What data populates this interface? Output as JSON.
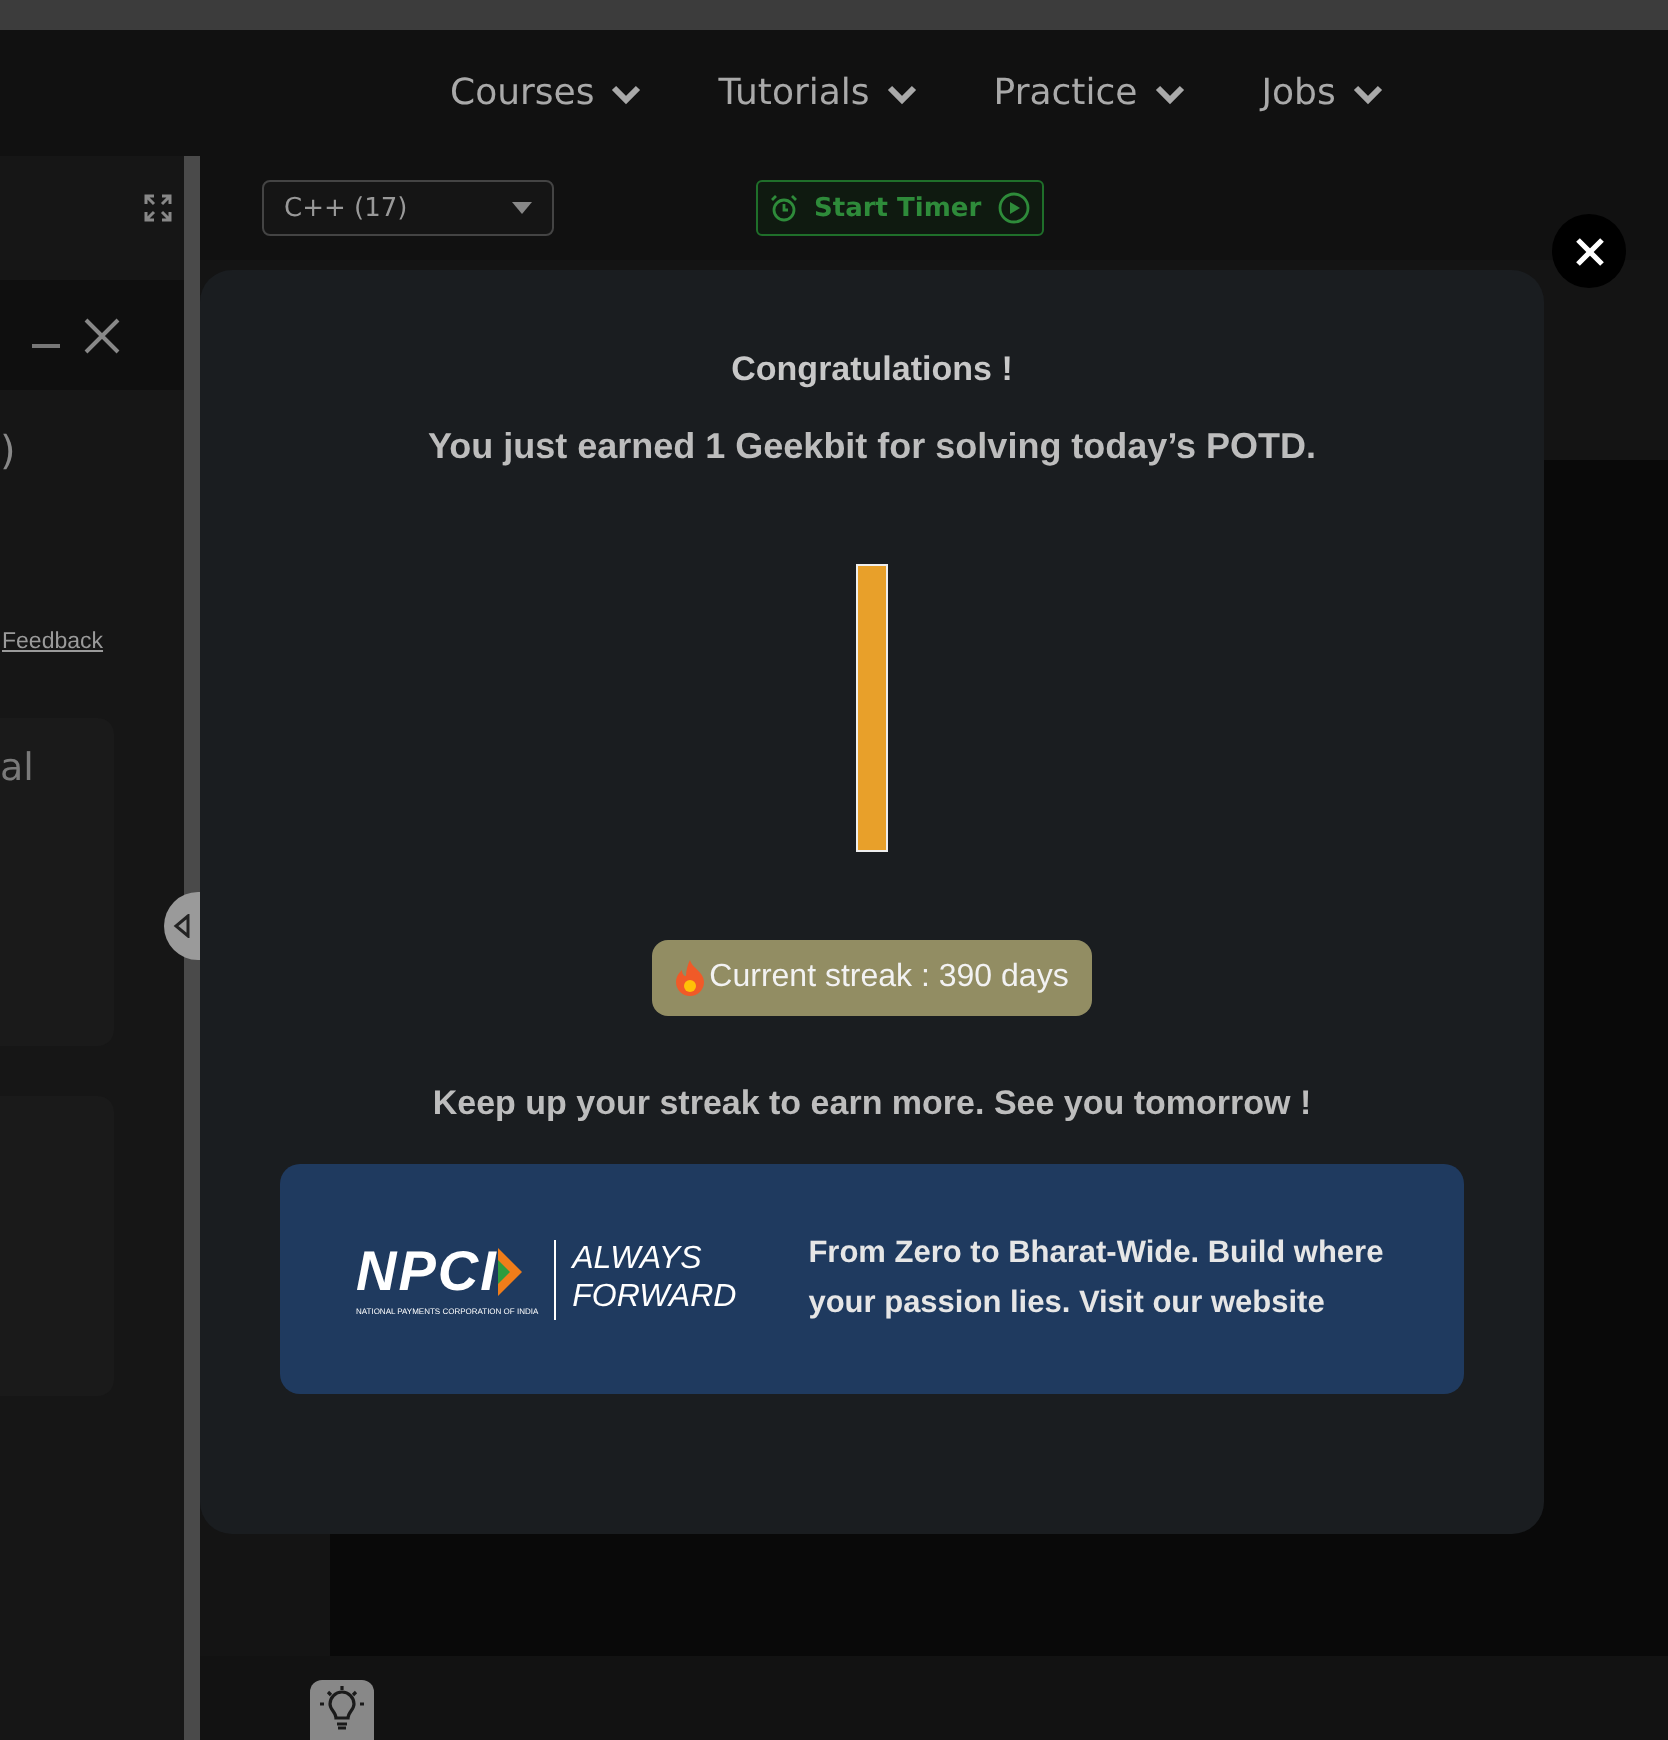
{
  "nav": [
    {
      "label": "Courses"
    },
    {
      "label": "Tutorials"
    },
    {
      "label": "Practice"
    },
    {
      "label": "Jobs"
    }
  ],
  "left_panel": {
    "heading_fragment": ")",
    "link": "Feedback",
    "card_text": "al"
  },
  "editor": {
    "language": "C++ (17)",
    "timer_button": "Start Timer"
  },
  "modal": {
    "title": "Congratulations !",
    "message": "You just earned 1 Geekbit for solving today’s POTD.",
    "streak": "Current streak : 390 days",
    "footer": "Keep up your streak to earn more. See you tomorrow !",
    "ad": {
      "logo": "NPCI",
      "logo_caption": "NATIONAL PAYMENTS CORPORATION OF INDIA",
      "tagline_1": "ALWAYS",
      "tagline_2": "FORWARD",
      "text": "From Zero to Bharat-Wide. Build where your passion lies. Visit our website"
    }
  }
}
